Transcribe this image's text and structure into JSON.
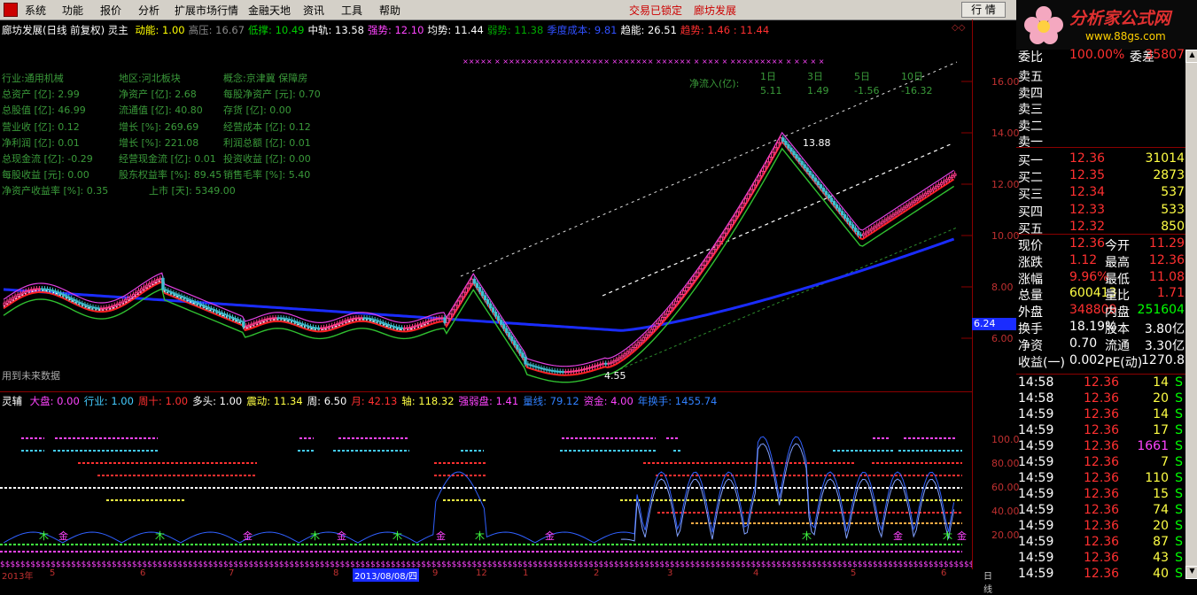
{
  "menu": {
    "items": [
      "系统",
      "功能",
      "报价",
      "分析",
      "扩展市场行情",
      "金融天地",
      "资讯",
      "工具",
      "帮助"
    ],
    "status": "交易已锁定",
    "stock": "廊坊发展",
    "btn1": "行 情"
  },
  "logo": {
    "title": "分析家公式网",
    "url": "www.88gs.com"
  },
  "main": {
    "title": "廊坊发展(日线 前复权) 灵主",
    "indicators": [
      {
        "label": "动能:",
        "value": "1.00",
        "color": "#ffff00"
      },
      {
        "label": "高压:",
        "value": "16.67",
        "color": "#888888"
      },
      {
        "label": "低撑:",
        "value": "10.49",
        "color": "#00cc00"
      },
      {
        "label": "中轨:",
        "value": "13.58",
        "color": "#ffffff"
      },
      {
        "label": "强势:",
        "value": "12.10",
        "color": "#ff44ff"
      },
      {
        "label": "均势:",
        "value": "11.44",
        "color": "#ffffff"
      },
      {
        "label": "弱势:",
        "value": "11.38",
        "color": "#00aa00"
      },
      {
        "label": "季度成本:",
        "value": "9.81",
        "color": "#3050ff"
      },
      {
        "label": "趋能:",
        "value": "26.51",
        "color": "#ffffff"
      },
      {
        "label": "趋势:",
        "value": "1.46 : 11.44",
        "color": "#ff3030"
      }
    ],
    "fundamentals": [
      [
        "行业:通用机械",
        "地区:河北板块",
        "概念:京津冀 保障房"
      ],
      [
        "总资产 [亿]:  2.99",
        "净资产 [亿]:  2.68",
        "每股净资产 [元]: 0.70"
      ],
      [
        "总股值 [亿]: 46.99",
        "流通值 [亿]: 40.80",
        "存货 [亿]:  0.00"
      ],
      [
        "营业收 [亿]:  0.12",
        "增长 [%]: 269.69",
        "经营成本 [亿]: 0.12"
      ],
      [
        "净利润 [亿]:  0.01",
        "增长 [%]: 221.08",
        "利润总额 [亿]: 0.01"
      ],
      [
        "总现金流 [亿]: -0.29",
        "经营现金流 [亿]: 0.01",
        "投资收益 [亿]:  0.00"
      ],
      [
        "每股收益 [元]:  0.00",
        "股东权益率 [%]: 89.45",
        "销售毛率 [%]:  5.40"
      ],
      [
        "净资产收益率 [%]: 0.35",
        "上市 [天]: 5349.00",
        ""
      ]
    ],
    "netflow": {
      "label": "净流入(亿):",
      "periods": [
        "1日",
        "3日",
        "5日",
        "10日"
      ],
      "values": [
        "5.11",
        "1.49",
        "-1.56",
        "-16.32"
      ]
    },
    "high_label": "13.88",
    "low_label": "4.55",
    "future_note": "用到未来数据",
    "price_axis": [
      "16.00",
      "14.00",
      "12.00",
      "10.00",
      "8.00",
      "6.00"
    ],
    "last_price_tag": "6.24"
  },
  "sub": {
    "title": "灵辅",
    "indicators": [
      {
        "label": "大盘:",
        "value": "0.00",
        "color": "#ff44ff"
      },
      {
        "label": "行业:",
        "value": "1.00",
        "color": "#44ccff"
      },
      {
        "label": "周十:",
        "value": "1.00",
        "color": "#ff3030"
      },
      {
        "label": "多头:",
        "value": "1.00",
        "color": "#ffffff"
      },
      {
        "label": "震动:",
        "value": "11.34",
        "color": "#ffff44"
      },
      {
        "label": "周:",
        "value": "6.50",
        "color": "#ffffff"
      },
      {
        "label": "月:",
        "value": "42.13",
        "color": "#ff3030"
      },
      {
        "label": "轴:",
        "value": "118.32",
        "color": "#ffff44"
      },
      {
        "label": "强弱盘:",
        "value": "1.41",
        "color": "#ff44ff"
      },
      {
        "label": "量线:",
        "value": "79.12",
        "color": "#3080ff"
      },
      {
        "label": "资金:",
        "value": "4.00",
        "color": "#ff44ff"
      },
      {
        "label": "年换手:",
        "value": "1455.74",
        "color": "#3080ff"
      }
    ],
    "axis": [
      "100.0",
      "80.00",
      "60.00",
      "40.00",
      "20.00"
    ],
    "markers": [
      "木",
      "金",
      "木",
      "金",
      "木",
      "金",
      "木",
      "金",
      "木",
      "金",
      "木",
      "金",
      "木",
      "金"
    ]
  },
  "bottom_axis": {
    "year": "2013年",
    "ticks": [
      "5",
      "6",
      "7",
      "8",
      "2013/08/08/四",
      "9",
      "12",
      "1",
      "2",
      "3",
      "4",
      "5",
      "6"
    ],
    "period": "日线"
  },
  "quote": {
    "top_row": {
      "l1": "委比",
      "v1": "100.00%",
      "l2": "委差",
      "v2": "35807"
    },
    "sells": [
      "卖五",
      "卖四",
      "卖三",
      "卖二",
      "卖一"
    ],
    "buys": [
      {
        "label": "买一",
        "price": "12.36",
        "vol": "31014"
      },
      {
        "label": "买二",
        "price": "12.35",
        "vol": "2873"
      },
      {
        "label": "买三",
        "price": "12.34",
        "vol": "537"
      },
      {
        "label": "买四",
        "price": "12.33",
        "vol": "533"
      },
      {
        "label": "买五",
        "price": "12.32",
        "vol": "850"
      }
    ],
    "stats": [
      {
        "l1": "现价",
        "v1": "12.36",
        "c1": "#ff3030",
        "l2": "今开",
        "v2": "11.29",
        "c2": "#ff3030"
      },
      {
        "l1": "涨跌",
        "v1": "1.12",
        "c1": "#ff3030",
        "l2": "最高",
        "v2": "12.36",
        "c2": "#ff3030"
      },
      {
        "l1": "涨幅",
        "v1": "9.96%",
        "c1": "#ff3030",
        "l2": "最低",
        "v2": "11.08",
        "c2": "#ff3030"
      },
      {
        "l1": "总量",
        "v1": "600413",
        "c1": "#ffff44",
        "l2": "量比",
        "v2": "1.71",
        "c2": "#ff3030"
      },
      {
        "l1": "外盘",
        "v1": "348809",
        "c1": "#ff3030",
        "l2": "内盘",
        "v2": "251604",
        "c2": "#00ff00"
      },
      {
        "l1": "换手",
        "v1": "18.19%",
        "c1": "#ffffff",
        "l2": "股本",
        "v2": "3.80亿",
        "c2": "#ffffff"
      },
      {
        "l1": "净资",
        "v1": "0.70",
        "c1": "#ffffff",
        "l2": "流通",
        "v2": "3.30亿",
        "c2": "#ffffff"
      },
      {
        "l1": "收益(一)",
        "v1": "0.002",
        "c1": "#ffffff",
        "l2": "PE(动)",
        "v2": "1270.8",
        "c2": "#ffffff"
      }
    ],
    "ticks": [
      {
        "time": "14:58",
        "price": "12.36",
        "vol": "14",
        "side": "S",
        "vc": "#ffff44"
      },
      {
        "time": "14:58",
        "price": "12.36",
        "vol": "20",
        "side": "S",
        "vc": "#ffff44"
      },
      {
        "time": "14:59",
        "price": "12.36",
        "vol": "14",
        "side": "S",
        "vc": "#ffff44"
      },
      {
        "time": "14:59",
        "price": "12.36",
        "vol": "17",
        "side": "S",
        "vc": "#ffff44"
      },
      {
        "time": "14:59",
        "price": "12.36",
        "vol": "1661",
        "side": "S",
        "vc": "#ff44ff"
      },
      {
        "time": "14:59",
        "price": "12.36",
        "vol": "7",
        "side": "S",
        "vc": "#ffff44"
      },
      {
        "time": "14:59",
        "price": "12.36",
        "vol": "110",
        "side": "S",
        "vc": "#ffff44"
      },
      {
        "time": "14:59",
        "price": "12.36",
        "vol": "15",
        "side": "S",
        "vc": "#ffff44"
      },
      {
        "time": "14:59",
        "price": "12.36",
        "vol": "74",
        "side": "S",
        "vc": "#ffff44"
      },
      {
        "time": "14:59",
        "price": "12.36",
        "vol": "20",
        "side": "S",
        "vc": "#ffff44"
      },
      {
        "time": "14:59",
        "price": "12.36",
        "vol": "87",
        "side": "S",
        "vc": "#ffff44"
      },
      {
        "time": "14:59",
        "price": "12.36",
        "vol": "43",
        "side": "S",
        "vc": "#ffff44"
      },
      {
        "time": "14:59",
        "price": "12.36",
        "vol": "40",
        "side": "S",
        "vc": "#ffff44"
      }
    ]
  }
}
